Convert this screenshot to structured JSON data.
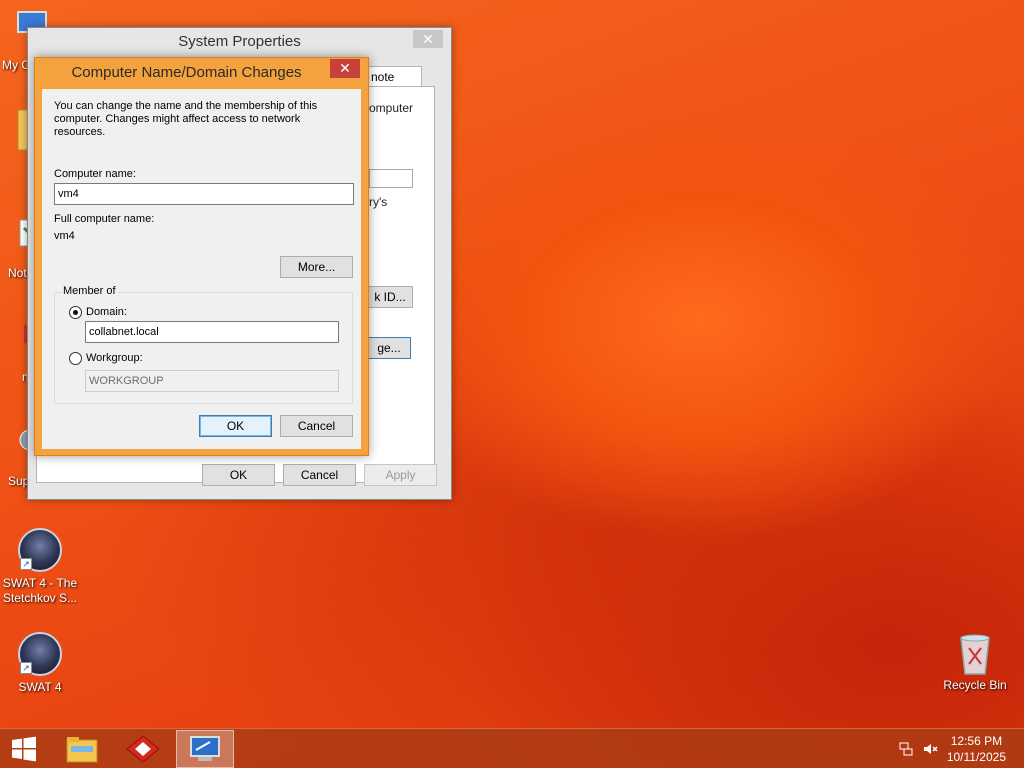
{
  "desktop": {
    "icons": [
      {
        "label": "SWAT 4 - The Stetchkov S..."
      },
      {
        "label": "SWAT 4"
      },
      {
        "label": "Recycle Bin"
      }
    ],
    "partial_labels": [
      "My C",
      "Not",
      "Sup",
      "n"
    ]
  },
  "system_properties": {
    "title": "System Properties",
    "close": "✕",
    "tab_fragment": "note",
    "frag_computer": "omputer",
    "frag_ys": "ry's",
    "frag_id_btn": "k ID...",
    "frag_change_btn": "ge...",
    "ok": "OK",
    "cancel": "Cancel",
    "apply": "Apply"
  },
  "name_dialog": {
    "title": "Computer Name/Domain Changes",
    "close": "✕",
    "description": "You can change the name and the membership of this computer. Changes might affect access to network resources.",
    "computer_name_label": "Computer name:",
    "computer_name_value": "vm4",
    "full_name_label": "Full computer name:",
    "full_name_value": "vm4",
    "more_button": "More...",
    "member_of_label": "Member of",
    "domain_label": "Domain:",
    "domain_value": "collabnet.local",
    "workgroup_label": "Workgroup:",
    "workgroup_value": "WORKGROUP",
    "domain_selected": true,
    "ok": "OK",
    "cancel": "Cancel"
  },
  "taskbar": {
    "items": [
      {
        "icon": "windows-start-icon"
      },
      {
        "icon": "file-explorer-icon"
      },
      {
        "icon": "app-icon-red-diamond"
      },
      {
        "icon": "system-properties-icon"
      }
    ],
    "time": "12:56 PM",
    "date": "10/11/2025"
  }
}
